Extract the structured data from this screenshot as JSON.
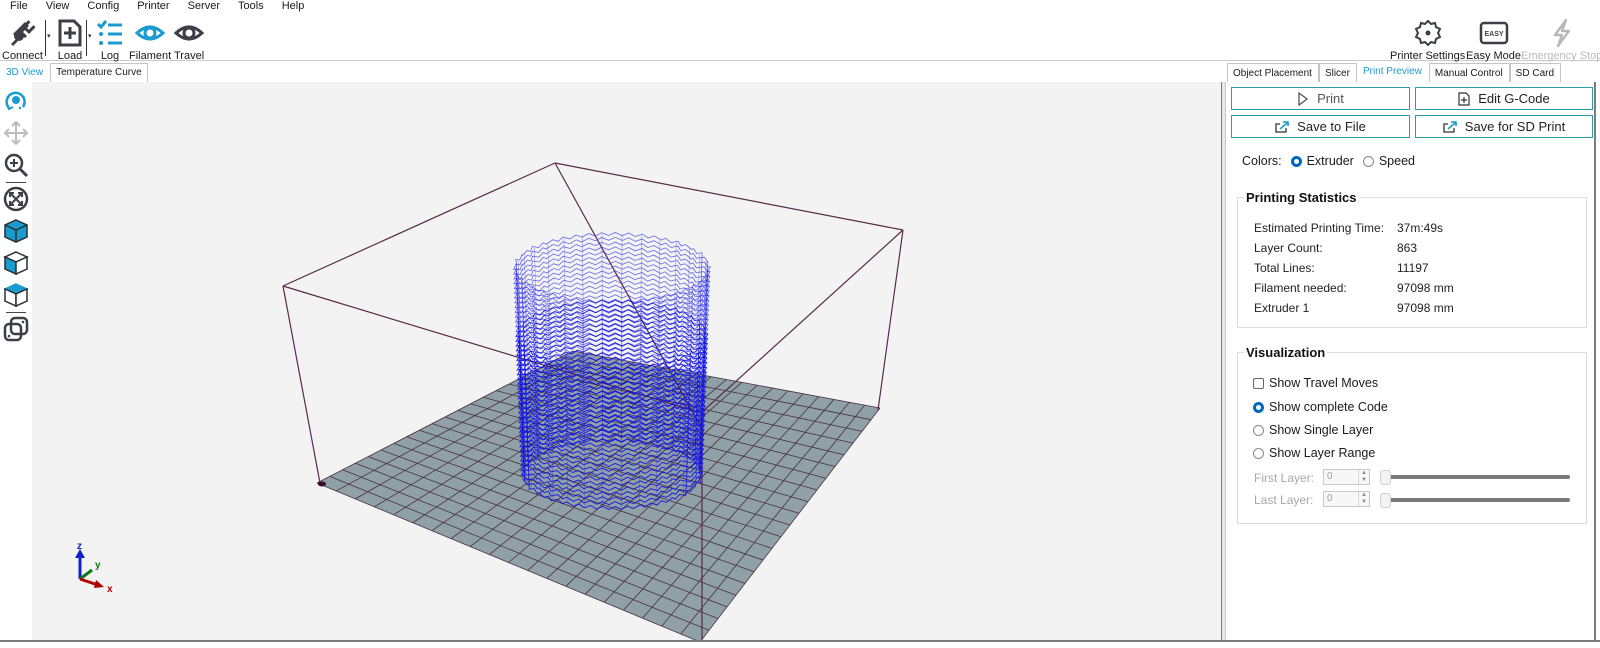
{
  "menu": [
    "File",
    "View",
    "Config",
    "Printer",
    "Server",
    "Tools",
    "Help"
  ],
  "toolbar": {
    "connect": "Connect",
    "load": "Load",
    "log": "Log",
    "filament": "Filament",
    "travel": "Travel",
    "printer_settings": "Printer Settings",
    "easy_mode": "Easy Mode",
    "easy_badge": "EASY",
    "emergency_stop": "Emergency Stop"
  },
  "left_tabs": [
    {
      "label": "3D View",
      "active": true
    },
    {
      "label": "Temperature Curve",
      "active": false
    }
  ],
  "view_tools": [
    "rotate-icon",
    "move-icon",
    "zoom-icon",
    "fit-view-icon",
    "iso-view-icon",
    "front-view-icon",
    "top-view-icon",
    "toggle-objects-icon"
  ],
  "axes": {
    "x": "x",
    "y": "y",
    "z": "z",
    "colors": {
      "x": "#b00000",
      "y": "#0a7a12",
      "z": "#1020c8"
    }
  },
  "right_tabs": [
    {
      "label": "Object Placement",
      "active": false
    },
    {
      "label": "Slicer",
      "active": false
    },
    {
      "label": "Print Preview",
      "active": true
    },
    {
      "label": "Manual Control",
      "active": false
    },
    {
      "label": "SD Card",
      "active": false
    }
  ],
  "actions": {
    "print": "Print",
    "edit_gcode": "Edit G-Code",
    "save_file": "Save to File",
    "save_sd": "Save for SD Print"
  },
  "colors_option": {
    "label": "Colors:",
    "options": [
      "Extruder",
      "Speed"
    ],
    "selected": "Extruder"
  },
  "statistics": {
    "title": "Printing Statistics",
    "rows": [
      {
        "label": "Estimated Printing Time:",
        "value": "37m:49s"
      },
      {
        "label": "Layer Count:",
        "value": "863"
      },
      {
        "label": "Total Lines:",
        "value": "11197"
      },
      {
        "label": "Filament needed:",
        "value": "97098 mm"
      },
      {
        "label": "Extruder 1",
        "value": "97098 mm"
      }
    ]
  },
  "visualization": {
    "title": "Visualization",
    "show_travel": {
      "label": "Show Travel Moves",
      "checked": false
    },
    "modes": [
      {
        "label": "Show complete Code",
        "selected": true
      },
      {
        "label": "Show Single Layer",
        "selected": false
      },
      {
        "label": "Show Layer Range",
        "selected": false
      }
    ],
    "first_layer": {
      "label": "First Layer:",
      "value": "0"
    },
    "last_layer": {
      "label": "Last Layer:",
      "value": "0"
    }
  },
  "theme": {
    "accent": "#1a9bd0",
    "button_border": "#2a9ea8",
    "radio": "#0067c0",
    "bed": "#8fa0a6",
    "frame": "#5a2a4a",
    "toolpath": "#1a1ae0"
  }
}
